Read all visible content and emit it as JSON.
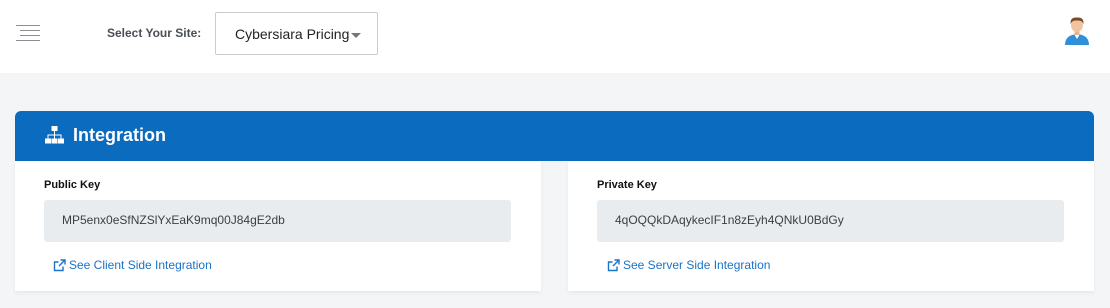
{
  "header": {
    "select_label": "Select Your Site:",
    "selected_site": "Cybersiara Pricing"
  },
  "card": {
    "title": "Integration",
    "accent_color": "#0b6cbf",
    "public": {
      "label": "Public Key",
      "value": "MP5enx0eSfNZSlYxEaK9mq00J84gE2db",
      "link": "See Client Side Integration"
    },
    "private": {
      "label": "Private Key",
      "value": "4qOQQkDAqykecIF1n8zEyh4QNkU0BdGy",
      "link": "See Server Side Integration"
    }
  }
}
